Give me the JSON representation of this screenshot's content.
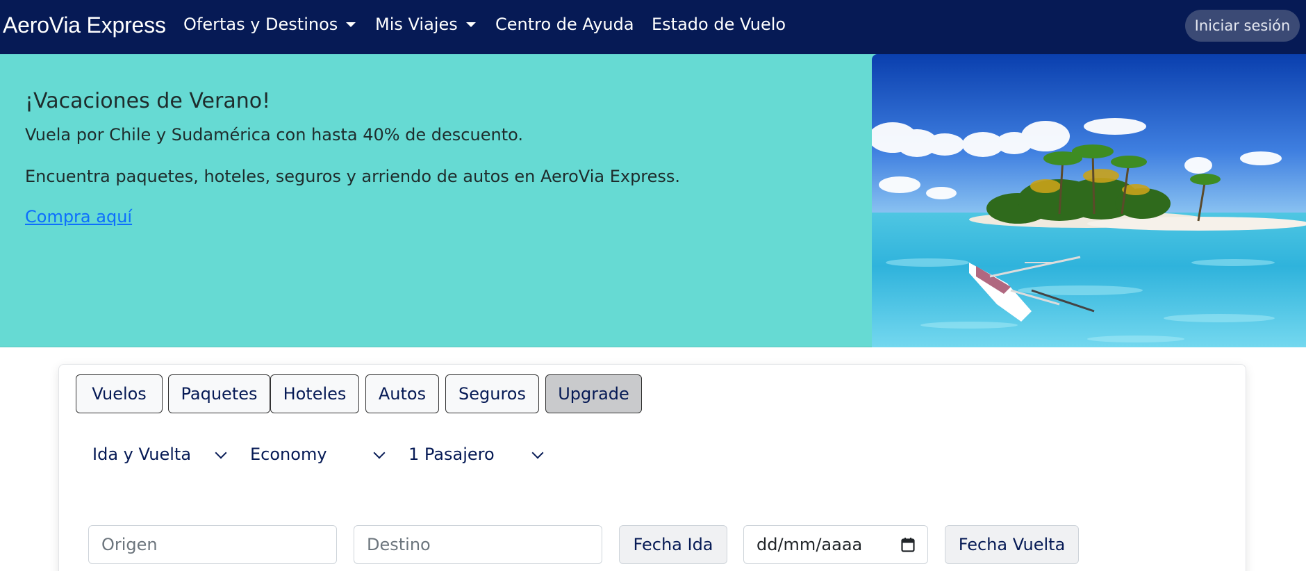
{
  "navbar": {
    "brand": "AeroVia Express",
    "items": [
      {
        "label": "Ofertas y Destinos",
        "dropdown": true
      },
      {
        "label": "Mis Viajes",
        "dropdown": true
      },
      {
        "label": "Centro de Ayuda",
        "dropdown": false
      },
      {
        "label": "Estado de Vuelo",
        "dropdown": false
      }
    ],
    "login_label": "Iniciar sesión"
  },
  "hero": {
    "title": "¡Vacaciones de Verano!",
    "line1": "Vuela por Chile y Sudamérica con hasta 40% de descuento.",
    "line2": "Encuentra paquetes, hoteles, seguros y arriendo de autos en AeroVia Express.",
    "link": "Compra aquí",
    "image": "tropical-island-beach"
  },
  "search": {
    "tabs": [
      {
        "label": "Vuelos",
        "active": false
      },
      {
        "label": "Paquetes",
        "active": false
      },
      {
        "label": "Hoteles",
        "active": false
      },
      {
        "label": "Autos",
        "active": false
      },
      {
        "label": "Seguros",
        "active": false
      },
      {
        "label": "Upgrade",
        "active": true
      }
    ],
    "trip_type": "Ida y Vuelta",
    "cabin": "Economy",
    "passengers": "1 Pasajero",
    "origin_placeholder": "Origen",
    "destination_placeholder": "Destino",
    "depart_label": "Fecha Ida",
    "date_placeholder": "dd/mm/aaaa",
    "return_label": "Fecha Vuelta"
  },
  "colors": {
    "navbar_bg": "#061a55",
    "hero_bg": "#66dad3",
    "link": "#0d6efd"
  }
}
